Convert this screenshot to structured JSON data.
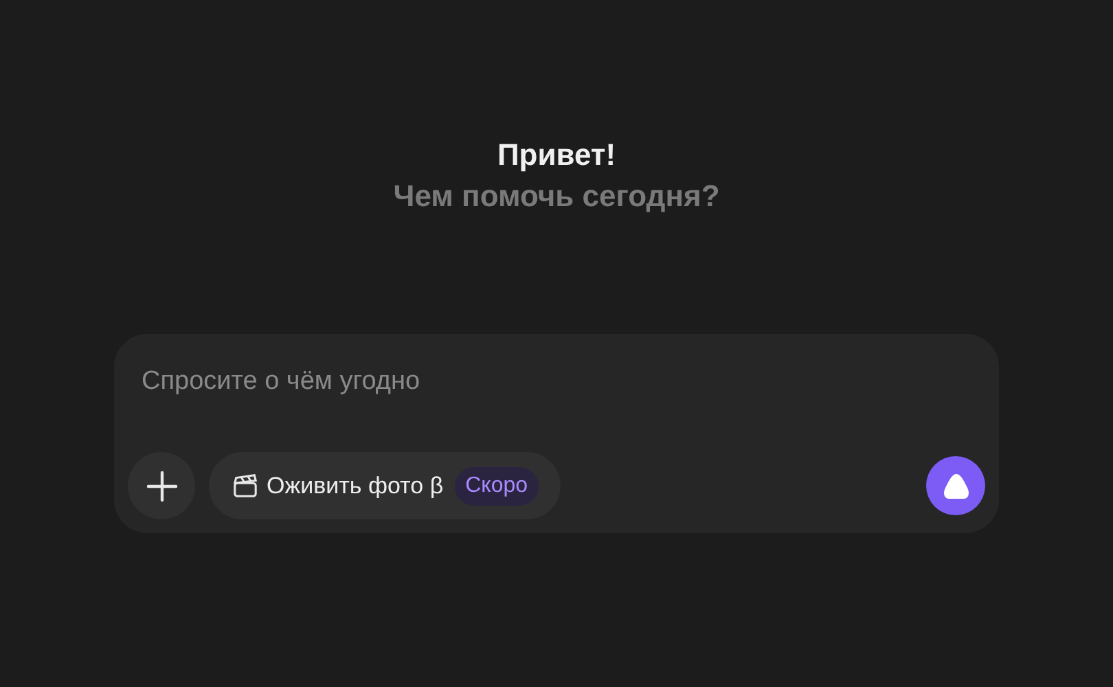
{
  "greeting": {
    "title": "Привет!",
    "subtitle": "Чем помочь сегодня?"
  },
  "composer": {
    "placeholder": "Спросите о чём угодно",
    "feature_chip": {
      "label": "Оживить фото β",
      "badge": "Скоро"
    }
  }
}
